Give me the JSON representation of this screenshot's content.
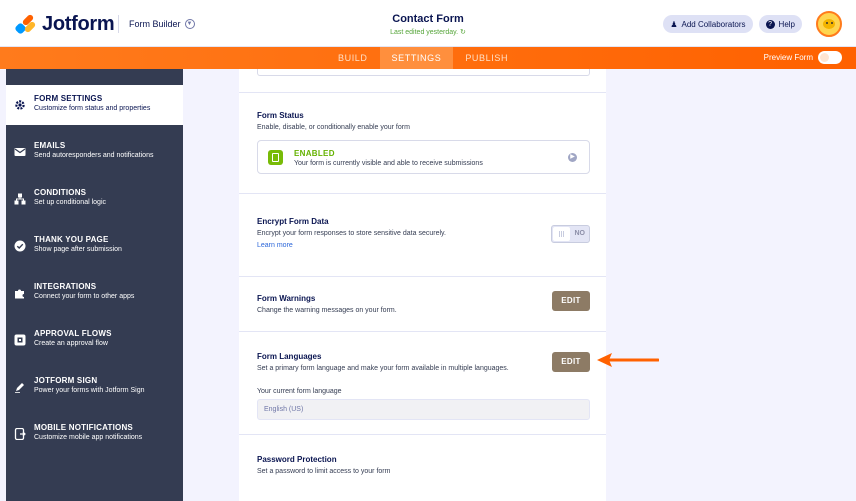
{
  "header": {
    "logo_text": "Jotform",
    "form_builder_label": "Form Builder",
    "form_title": "Contact Form",
    "last_edited": "Last edited yesterday.",
    "add_collaborators": "Add Collaborators",
    "help": "Help"
  },
  "tabs": [
    {
      "label": "BUILD"
    },
    {
      "label": "SETTINGS",
      "active": true
    },
    {
      "label": "PUBLISH"
    }
  ],
  "preview_form": "Preview Form",
  "sidebar": {
    "items": [
      {
        "title": "FORM SETTINGS",
        "desc": "Customize form status and properties",
        "icon": "gear-icon",
        "active": true
      },
      {
        "title": "EMAILS",
        "desc": "Send autoresponders and notifications",
        "icon": "envelope-icon"
      },
      {
        "title": "CONDITIONS",
        "desc": "Set up conditional logic",
        "icon": "conditions-icon"
      },
      {
        "title": "THANK YOU PAGE",
        "desc": "Show page after submission",
        "icon": "check-circle-icon"
      },
      {
        "title": "INTEGRATIONS",
        "desc": "Connect your form to other apps",
        "icon": "puzzle-icon"
      },
      {
        "title": "APPROVAL FLOWS",
        "desc": "Create an approval flow",
        "icon": "approval-icon"
      },
      {
        "title": "JOTFORM SIGN",
        "desc": "Power your forms with Jotform Sign",
        "icon": "pen-icon"
      },
      {
        "title": "MOBILE NOTIFICATIONS",
        "desc": "Customize mobile app notifications",
        "icon": "mobile-icon"
      }
    ]
  },
  "main": {
    "form_status": {
      "title": "Form Status",
      "desc": "Enable, disable, or conditionally enable your form",
      "status_label": "ENABLED",
      "status_desc": "Your form is currently visible and able to receive submissions"
    },
    "encrypt": {
      "title": "Encrypt Form Data",
      "desc": "Encrypt your form responses to store sensitive data securely.",
      "learn_more": "Learn more",
      "switch_label": "NO"
    },
    "warnings": {
      "title": "Form Warnings",
      "desc": "Change the warning messages on your form.",
      "button": "EDIT"
    },
    "languages": {
      "title": "Form Languages",
      "desc": "Set a primary form language and make your form available in multiple languages.",
      "button": "EDIT",
      "current_label": "Your current form language",
      "current_value": "English (US)"
    },
    "password": {
      "title": "Password Protection",
      "desc": "Set a password to limit access to your form"
    }
  },
  "colors": {
    "orange": "#ff6100",
    "sidebar": "#343c52",
    "edit_button": "#8d7b65",
    "enabled_green": "#64b200"
  }
}
